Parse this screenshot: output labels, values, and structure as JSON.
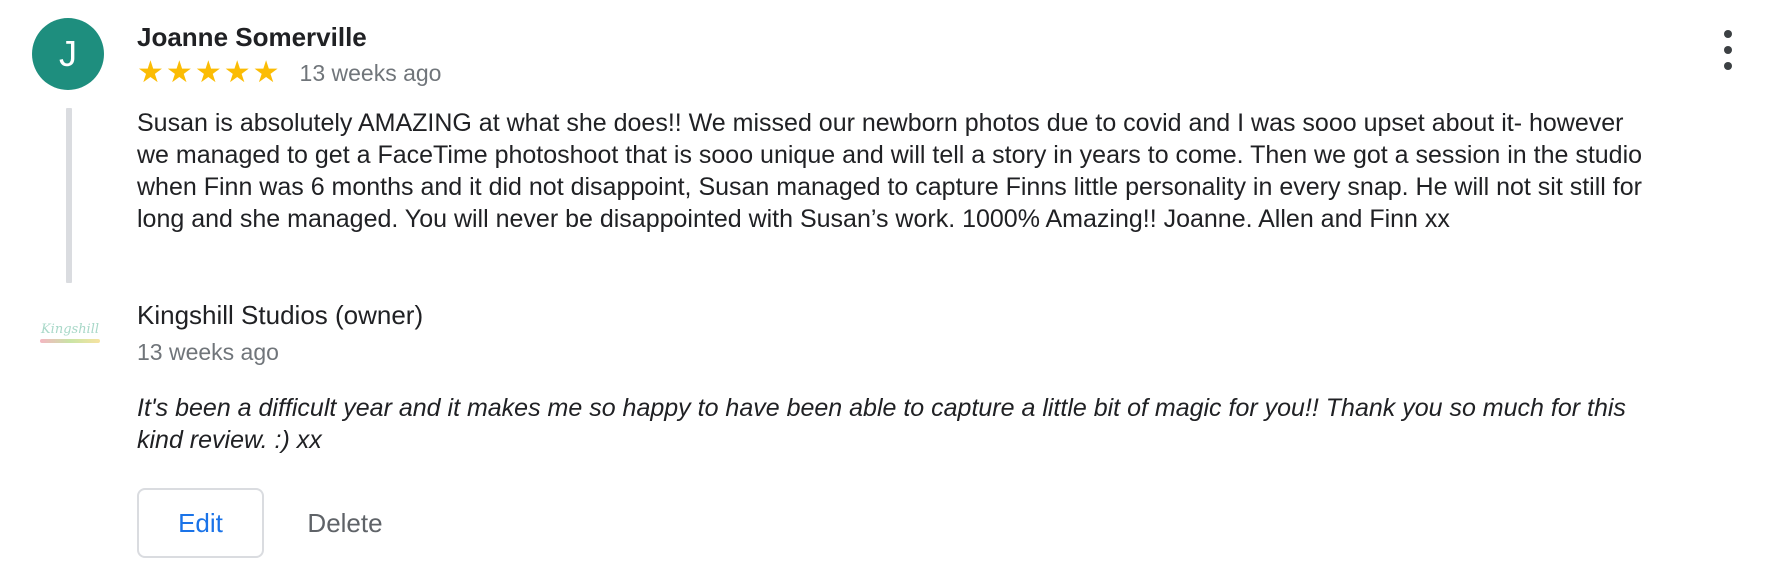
{
  "review": {
    "avatar_initial": "J",
    "reviewer_name": "Joanne Somerville",
    "rating": 5,
    "max_rating": 5,
    "star_color": "#fbbc04",
    "time_ago": "13 weeks ago",
    "text": "Susan is absolutely AMAZING at what she does!! We missed our newborn photos due to covid and I was sooo upset about it- however we managed to get a FaceTime photoshoot that is sooo unique and will tell a story in years to come. Then we got a session in the studio when Finn was 6 months and it did not disappoint, Susan managed to capture Finns little personality in every snap. He will not sit still for long and she managed. You will never be disappointed with Susan’s work. 1000% Amazing!! Joanne. Allen and Finn xx"
  },
  "owner_response": {
    "logo_text": "Kingshill Studios",
    "owner_name": "Kingshill Studios (owner)",
    "time_ago": "13 weeks ago",
    "text": "It's been a difficult year and it makes me so happy to have been able to capture a little bit of magic for you!! Thank you so much for this kind review. :) xx"
  },
  "actions": {
    "edit_label": "Edit",
    "delete_label": "Delete",
    "more_icon": "more-vert-icon"
  },
  "colors": {
    "avatar_bg": "#1e8e7e",
    "accent_blue": "#1a73e8",
    "secondary_text": "#70757a"
  }
}
